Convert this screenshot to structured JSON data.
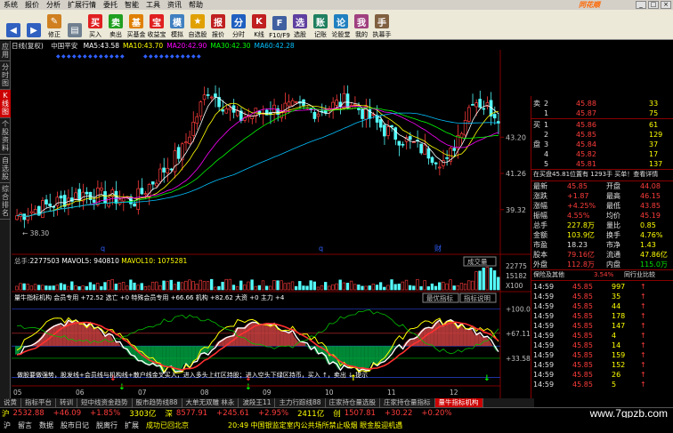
{
  "menu": {
    "items": [
      "系统",
      "报价",
      "分析",
      "扩展行情",
      "委托",
      "智能",
      "工具",
      "资讯",
      "帮助"
    ],
    "brand": "同花顺"
  },
  "toolbar": {
    "buttons": [
      {
        "label": "",
        "icon": "back-icon"
      },
      {
        "label": "",
        "icon": "forward-icon"
      },
      {
        "label": "修正",
        "icon": "edit-icon"
      },
      {
        "label": "",
        "icon": "page-icon"
      },
      {
        "label": "买入",
        "icon": "buy-icon"
      },
      {
        "label": "卖出",
        "icon": "sell-icon"
      },
      {
        "label": "买基金",
        "icon": "fund-icon"
      },
      {
        "label": "收益宝",
        "icon": "treasure-icon"
      },
      {
        "label": "模拟",
        "icon": "sim-icon"
      },
      {
        "label": "自选股",
        "icon": "star-icon"
      },
      {
        "label": "报价",
        "icon": "quote-icon"
      },
      {
        "label": "分时",
        "icon": "timeline-icon"
      },
      {
        "label": "K线",
        "icon": "kline-icon"
      },
      {
        "label": "F10/F9",
        "icon": "info-icon"
      },
      {
        "label": "选股",
        "icon": "filter-icon"
      },
      {
        "label": "记账",
        "icon": "ledger-icon"
      },
      {
        "label": "论股堂",
        "icon": "forum-icon"
      },
      {
        "label": "我的",
        "icon": "user-icon"
      },
      {
        "label": "执幕手",
        "icon": "hand-icon"
      }
    ]
  },
  "sidetabs": [
    "应用",
    "分时图",
    "K线图",
    "个股资料",
    "自选股",
    "综合排名"
  ],
  "chart": {
    "period_label": "日线(复权)",
    "stock_name": "中国平安",
    "ma": [
      {
        "label": "MA5:",
        "value": "43.58",
        "color": "#ffffff"
      },
      {
        "label": "MA10:",
        "value": "43.70",
        "color": "#ffff00"
      },
      {
        "label": "MA20:",
        "value": "42.90",
        "color": "#ff00ff"
      },
      {
        "label": "MA30:",
        "value": "42.30",
        "color": "#00ff00"
      },
      {
        "label": "MA60:",
        "value": "42.28",
        "color": "#00c0ff"
      }
    ],
    "price_ticks": [
      "43.20",
      "41.26",
      "39.32"
    ],
    "low_label": "38.30",
    "volume_header": {
      "label": "总手:",
      "value": "2277503",
      "mavol5": "MAVOL5: 940810",
      "mavol10": "MAVOL10: 1075281"
    },
    "volume_button": "成交量",
    "volume_ticks": [
      "22775",
      "15182",
      "X100"
    ],
    "indicator_header": "量牛指标机构 会员专用 +72.52 选亡 +0 特殊会员专用 +66.66 机构 +82.62 大资 +0 主力 +4",
    "indicator_buttons": [
      "最优指标",
      "指标说明"
    ],
    "indicator_ticks": [
      "+100.0",
      "+67.11",
      "+33.58"
    ],
    "indicator_note": "做股要做强势，股发线+会员线与机构线+散户线金叉买入，进入多头上红区持股；进入空头下绿区持币，买入 ↑，卖出 ↓ 提示",
    "date_ticks": [
      "05",
      "06",
      "07",
      "08",
      "09",
      "10",
      "11",
      "12"
    ]
  },
  "quote": {
    "sell": [
      {
        "label": "卖",
        "level": "2",
        "price": "45.88",
        "vol": "33"
      },
      {
        "label": "",
        "level": "1",
        "price": "45.87",
        "vol": "75"
      }
    ],
    "buy": [
      {
        "label": "买",
        "level": "1",
        "price": "45.86",
        "vol": "61"
      },
      {
        "label": "",
        "level": "2",
        "price": "45.85",
        "vol": "129"
      },
      {
        "label": "盘",
        "level": "3",
        "price": "45.84",
        "vol": "37"
      },
      {
        "label": "",
        "level": "4",
        "price": "45.82",
        "vol": "17"
      },
      {
        "label": "",
        "level": "5",
        "price": "45.81",
        "vol": "137"
      }
    ],
    "order_line": "在买盘45.81位置有 1293手 买单！查看详情",
    "stats": [
      {
        "l1": "最新",
        "v1": "45.85",
        "l2": "开盘",
        "v2": "44.08"
      },
      {
        "l1": "涨跌",
        "v1": "+1.87",
        "l2": "最高",
        "v2": "46.15"
      },
      {
        "l1": "涨幅",
        "v1": "+4.25%",
        "l2": "最低",
        "v2": "43.85"
      },
      {
        "l1": "振幅",
        "v1": "4.55%",
        "l2": "均价",
        "v2": "45.19"
      },
      {
        "l1": "总手",
        "v1": "227.8万",
        "l2": "量比",
        "v2": "0.85"
      },
      {
        "l1": "金额",
        "v1": "103.9亿",
        "l2": "换手",
        "v2": "4.76%"
      },
      {
        "l1": "市盈",
        "v1": "18.23",
        "l2": "市净",
        "v2": "1.43"
      },
      {
        "l1": "股本",
        "v1": "79.16亿",
        "l2": "流通",
        "v2": "47.86亿"
      },
      {
        "l1": "外盘",
        "v1": "112.8万",
        "l2": "内盘",
        "v2": "115.0万"
      }
    ],
    "extra": {
      "label": "保险及其他",
      "value": "3.54%",
      "tail": "同行业比较"
    },
    "ticks": [
      {
        "time": "14:59",
        "price": "45.85",
        "vol": "997",
        "dir": "up"
      },
      {
        "time": "14:59",
        "price": "45.85",
        "vol": "35",
        "dir": "up"
      },
      {
        "time": "14:59",
        "price": "45.85",
        "vol": "44",
        "dir": "up"
      },
      {
        "time": "14:59",
        "price": "45.85",
        "vol": "178",
        "dir": "up"
      },
      {
        "time": "14:59",
        "price": "45.85",
        "vol": "147",
        "dir": "up"
      },
      {
        "time": "14:59",
        "price": "45.85",
        "vol": "4",
        "dir": "up"
      },
      {
        "time": "14:59",
        "price": "45.85",
        "vol": "14",
        "dir": "up"
      },
      {
        "time": "14:59",
        "price": "45.85",
        "vol": "159",
        "dir": "up"
      },
      {
        "time": "14:59",
        "price": "45.85",
        "vol": "152",
        "dir": "up"
      },
      {
        "time": "14:59",
        "price": "45.85",
        "vol": "26",
        "dir": "up"
      },
      {
        "time": "14:59",
        "price": "45.85",
        "vol": "5",
        "dir": "up"
      }
    ]
  },
  "bottom_tabs": [
    "说黄",
    "指标平台",
    "转训",
    "短中线资金趋势",
    "股市趋势线88",
    "大单无双雕 林永",
    "波段王11",
    "主力行踪线88",
    "庄家持仓量选股",
    "庄家持仓量指标",
    "量牛指标机构"
  ],
  "status": {
    "sh_label": "沪",
    "sh_index": "2532.88",
    "sh_change": "+46.09",
    "sh_pct": "+1.85%",
    "sh_amount": "3303亿",
    "sz_label": "深",
    "sz_index": "8577.91",
    "sz_change": "+245.61",
    "sz_pct": "+2.95%",
    "sz_amount": "2411亿",
    "cy_label": "创",
    "cy_index": "1507.81",
    "cy_change": "+30.22",
    "cy_pct": "+0.20%"
  },
  "status2": {
    "items": [
      "沪",
      "留言",
      "数据",
      "股市日记",
      "脱离行",
      "扩展",
      "成功已回北京"
    ],
    "news": "20:49 中国银监定室内公共场所禁止吸烟 眼金股迎机遇"
  },
  "watermark": "www.7gpzb.com"
}
